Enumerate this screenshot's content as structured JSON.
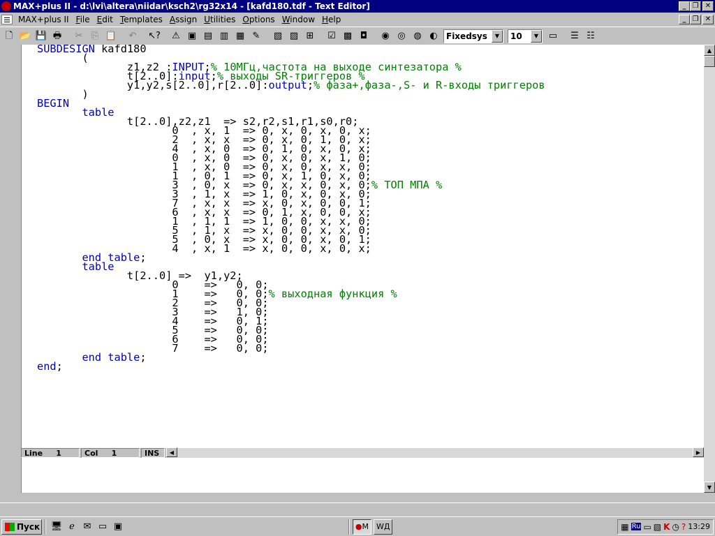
{
  "window": {
    "title": "MAX+plus II - d:\\lvi\\altera\\niidar\\ksch2\\rg32x14 - [kafd180.tdf - Text Editor]",
    "controls": {
      "minimize": "_",
      "restore": "❐",
      "close": "✕"
    }
  },
  "menubar": {
    "items": [
      {
        "label": "MAX+plus II",
        "ul": ""
      },
      {
        "label": "File",
        "ul": "F"
      },
      {
        "label": "Edit",
        "ul": "E"
      },
      {
        "label": "Templates",
        "ul": "T"
      },
      {
        "label": "Assign",
        "ul": "A"
      },
      {
        "label": "Utilities",
        "ul": "U"
      },
      {
        "label": "Options",
        "ul": "O"
      },
      {
        "label": "Window",
        "ul": "W"
      },
      {
        "label": "Help",
        "ul": "H"
      }
    ]
  },
  "toolbar": {
    "font_name": "Fixedsys",
    "font_size": "10"
  },
  "editor": {
    "lines": [
      [
        [
          "kw",
          "SUBDESIGN"
        ],
        [
          "n",
          " kafd180"
        ]
      ],
      [
        [
          "n",
          "       ("
        ]
      ],
      [
        [
          "n",
          "              z1,z2 :"
        ],
        [
          "kw",
          "INPUT"
        ],
        [
          "n",
          ";"
        ],
        [
          "cm",
          "% 10МГц,частота на выходе синтезатора %"
        ]
      ],
      [
        [
          "n",
          "              t[2..0]:"
        ],
        [
          "kw",
          "input"
        ],
        [
          "n",
          ";"
        ],
        [
          "cm",
          "% выходы SR-триггеров %"
        ]
      ],
      [
        [
          "n",
          "              y1,y2,s[2..0],r[2..0]:"
        ],
        [
          "kw",
          "output"
        ],
        [
          "n",
          ";"
        ],
        [
          "cm",
          "% фаза+,фаза-,S- и R-входы триггеров"
        ]
      ],
      [
        [
          "n",
          "       )"
        ]
      ],
      [
        [
          "kw",
          "BEGIN"
        ]
      ],
      [
        [
          "n",
          "       "
        ],
        [
          "kw",
          "table"
        ]
      ],
      [
        [
          "n",
          "              t[2..0],z2,z1  => s2,r2,s1,r1,s0,r0;"
        ]
      ],
      [
        [
          "n",
          "                     0  , x, 1  => 0, x, 0, x, 0, x;"
        ]
      ],
      [
        [
          "n",
          "                     2  , x, x  => 0, x, 0, 1, 0, x;"
        ]
      ],
      [
        [
          "n",
          "                     4  , x, 0  => 0, 1, 0, x, 0, x;"
        ]
      ],
      [
        [
          "n",
          "                     0  , x, 0  => 0, x, 0, x, 1, 0;"
        ]
      ],
      [
        [
          "n",
          "                     1  , x, 0  => 0, x, 0, x, x, 0;"
        ]
      ],
      [
        [
          "n",
          "                     1  , 0, 1  => 0, x, 1, 0, x, 0;"
        ]
      ],
      [
        [
          "n",
          "                     3  , 0, x  => 0, x, x, 0, x, 0;"
        ],
        [
          "cm",
          "% ТОП МПА %"
        ]
      ],
      [
        [
          "n",
          "                     3  , 1, x  => 1, 0, x, 0, x, 0;"
        ]
      ],
      [
        [
          "n",
          "                     7  , x, x  => x, 0, x, 0, 0, 1;"
        ]
      ],
      [
        [
          "n",
          "                     6  , x, x  => 0, 1, x, 0, 0, x;"
        ]
      ],
      [
        [
          "n",
          "                     1  , 1, 1  => 1, 0, 0, x, x, 0;"
        ]
      ],
      [
        [
          "n",
          "                     5  , 1, x  => x, 0, 0, x, x, 0;"
        ]
      ],
      [
        [
          "n",
          "                     5  , 0, x  => x, 0, 0, x, 0, 1;"
        ]
      ],
      [
        [
          "n",
          "                     4  , x, 1  => x, 0, 0, x, 0, x;"
        ]
      ],
      [
        [
          "n",
          "       "
        ],
        [
          "kw",
          "end table"
        ],
        [
          "n",
          ";"
        ]
      ],
      [
        [
          "n",
          "       "
        ],
        [
          "kw",
          "table"
        ]
      ],
      [
        [
          "n",
          "              t[2..0] =>  y1,y2;"
        ]
      ],
      [
        [
          "n",
          "                     0    =>   0, 0;"
        ]
      ],
      [
        [
          "n",
          "                     1    =>   0, 0;"
        ],
        [
          "cm",
          "% выходная функция %"
        ]
      ],
      [
        [
          "n",
          "                     2    =>   0, 0;"
        ]
      ],
      [
        [
          "n",
          "                     3    =>   1, 0;"
        ]
      ],
      [
        [
          "n",
          "                     4    =>   0, 1;"
        ]
      ],
      [
        [
          "n",
          "                     5    =>   0, 0;"
        ]
      ],
      [
        [
          "n",
          "                     6    =>   0, 0;"
        ]
      ],
      [
        [
          "n",
          "                     7    =>   0, 0;"
        ]
      ],
      [
        [
          "n",
          "       "
        ],
        [
          "kw",
          "end table"
        ],
        [
          "n",
          ";"
        ]
      ],
      [
        [
          "kw",
          "end"
        ],
        [
          "n",
          ";"
        ]
      ]
    ]
  },
  "status": {
    "line_label": "Line",
    "line_value": "1",
    "col_label": "Col",
    "col_value": "1",
    "mode": "INS"
  },
  "taskbar": {
    "start_label": "Пуск",
    "task1_label": "M",
    "task2_label": "Д",
    "clock": "13:29",
    "lang": "Ru"
  },
  "colors": {
    "keyword": "#0000c0",
    "comment": "#008000",
    "titlebar": "#000080"
  }
}
